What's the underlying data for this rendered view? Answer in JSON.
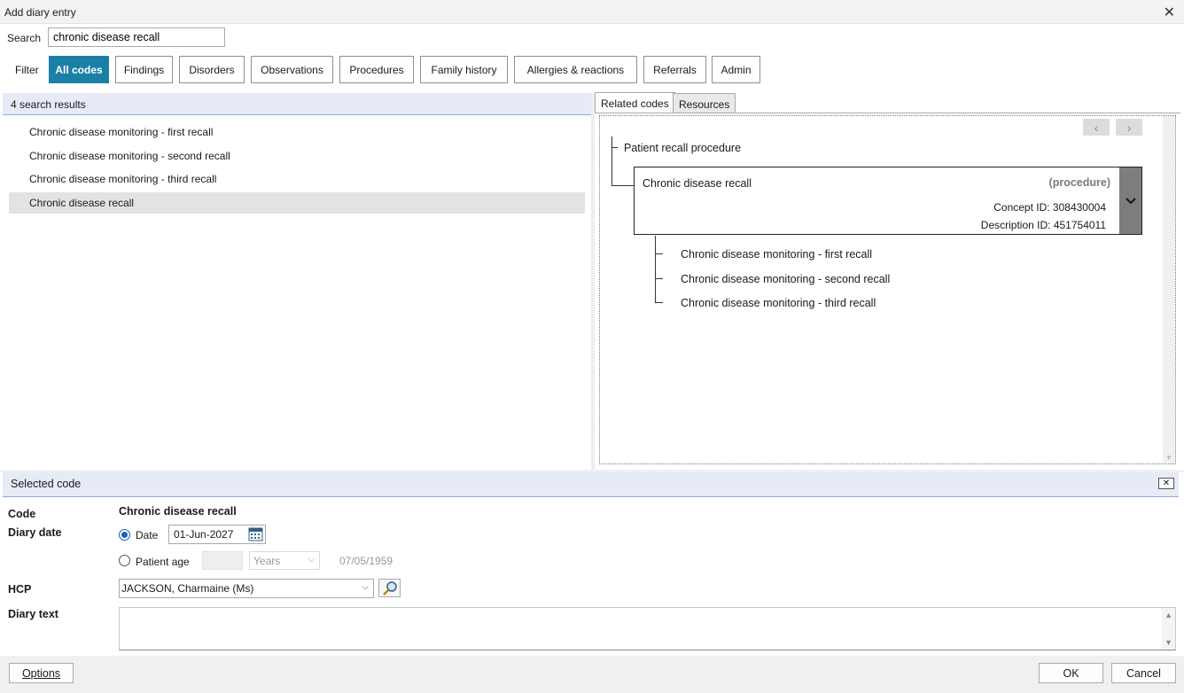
{
  "window": {
    "title": "Add diary entry"
  },
  "search": {
    "label": "Search",
    "value": "chronic disease recall"
  },
  "filter": {
    "label": "Filter",
    "buttons": [
      "All codes",
      "Findings",
      "Disorders",
      "Observations",
      "Procedures",
      "Family history",
      "Allergies & reactions",
      "Referrals",
      "Admin"
    ],
    "active": "All codes"
  },
  "results": {
    "count_text": "4 search results",
    "items": [
      "Chronic disease monitoring - first recall",
      "Chronic disease monitoring - second recall",
      "Chronic disease monitoring - third recall",
      "Chronic disease recall"
    ],
    "selected_index": 3
  },
  "tabs": {
    "related": "Related codes",
    "resources": "Resources"
  },
  "related": {
    "parent": "Patient recall procedure",
    "concept": {
      "name": "Chronic disease recall",
      "semantic_tag": "(procedure)",
      "concept_id": "Concept ID: 308430004",
      "description_id": "Description ID: 451754011"
    },
    "children": [
      "Chronic disease monitoring - first recall",
      "Chronic disease monitoring - second recall",
      "Chronic disease monitoring - third recall"
    ]
  },
  "selected_code": {
    "header": "Selected code",
    "code_label": "Code",
    "code_value": "Chronic disease recall",
    "diary_date_label": "Diary date",
    "date_option": "Date",
    "date_value": "01-Jun-2027",
    "age_option": "Patient age",
    "age_unit": "Years",
    "dob": "07/05/1959",
    "hcp_label": "HCP",
    "hcp_value": "JACKSON, Charmaine (Ms)",
    "diary_text_label": "Diary text"
  },
  "footer": {
    "options": "Options",
    "ok": "OK",
    "cancel": "Cancel"
  },
  "colors": {
    "accent": "#1c7fa6",
    "header_bg": "#e6ebf7",
    "selected_row": "#e3e3e3"
  },
  "icons": [
    "close-icon",
    "chevron-left-icon",
    "chevron-right-icon",
    "chevron-down-icon",
    "calendar-icon",
    "magnifier-icon"
  ]
}
